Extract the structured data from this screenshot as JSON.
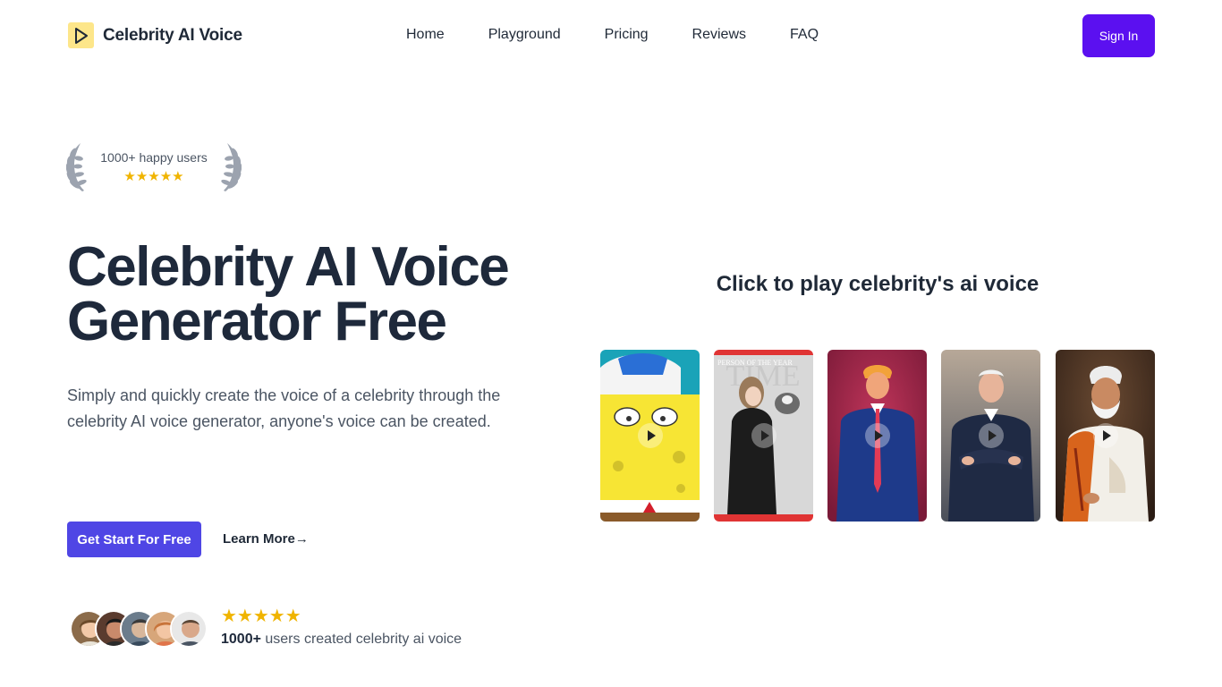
{
  "header": {
    "logo_text": "Celebrity AI Voice",
    "logo_icon": "play-icon",
    "nav": [
      "Home",
      "Playground",
      "Pricing",
      "Reviews",
      "FAQ"
    ],
    "signin_label": "Sign In"
  },
  "badge": {
    "text": "1000+ happy users",
    "stars": "★★★★★",
    "rating": 5
  },
  "hero": {
    "title_line1": "Celebrity AI Voice",
    "title_line2": "Generator Free",
    "description": "Simply and quickly create the voice of a celebrity through the celebrity AI voice generator, anyone's voice can be created.",
    "cta_label": "Get Start For Free",
    "learn_more_label": "Learn More→"
  },
  "social_proof": {
    "stars": "★★★★★",
    "count": "1000+",
    "text": " users created celebrity ai voice"
  },
  "voices": {
    "title": "Click to play celebrity's ai voice",
    "cover_text": "PERSON OF THE YEAR"
  },
  "colors": {
    "primary": "#5b10f0",
    "cta": "#4f46e5",
    "star": "#f0b400",
    "heading": "#1e293b"
  }
}
